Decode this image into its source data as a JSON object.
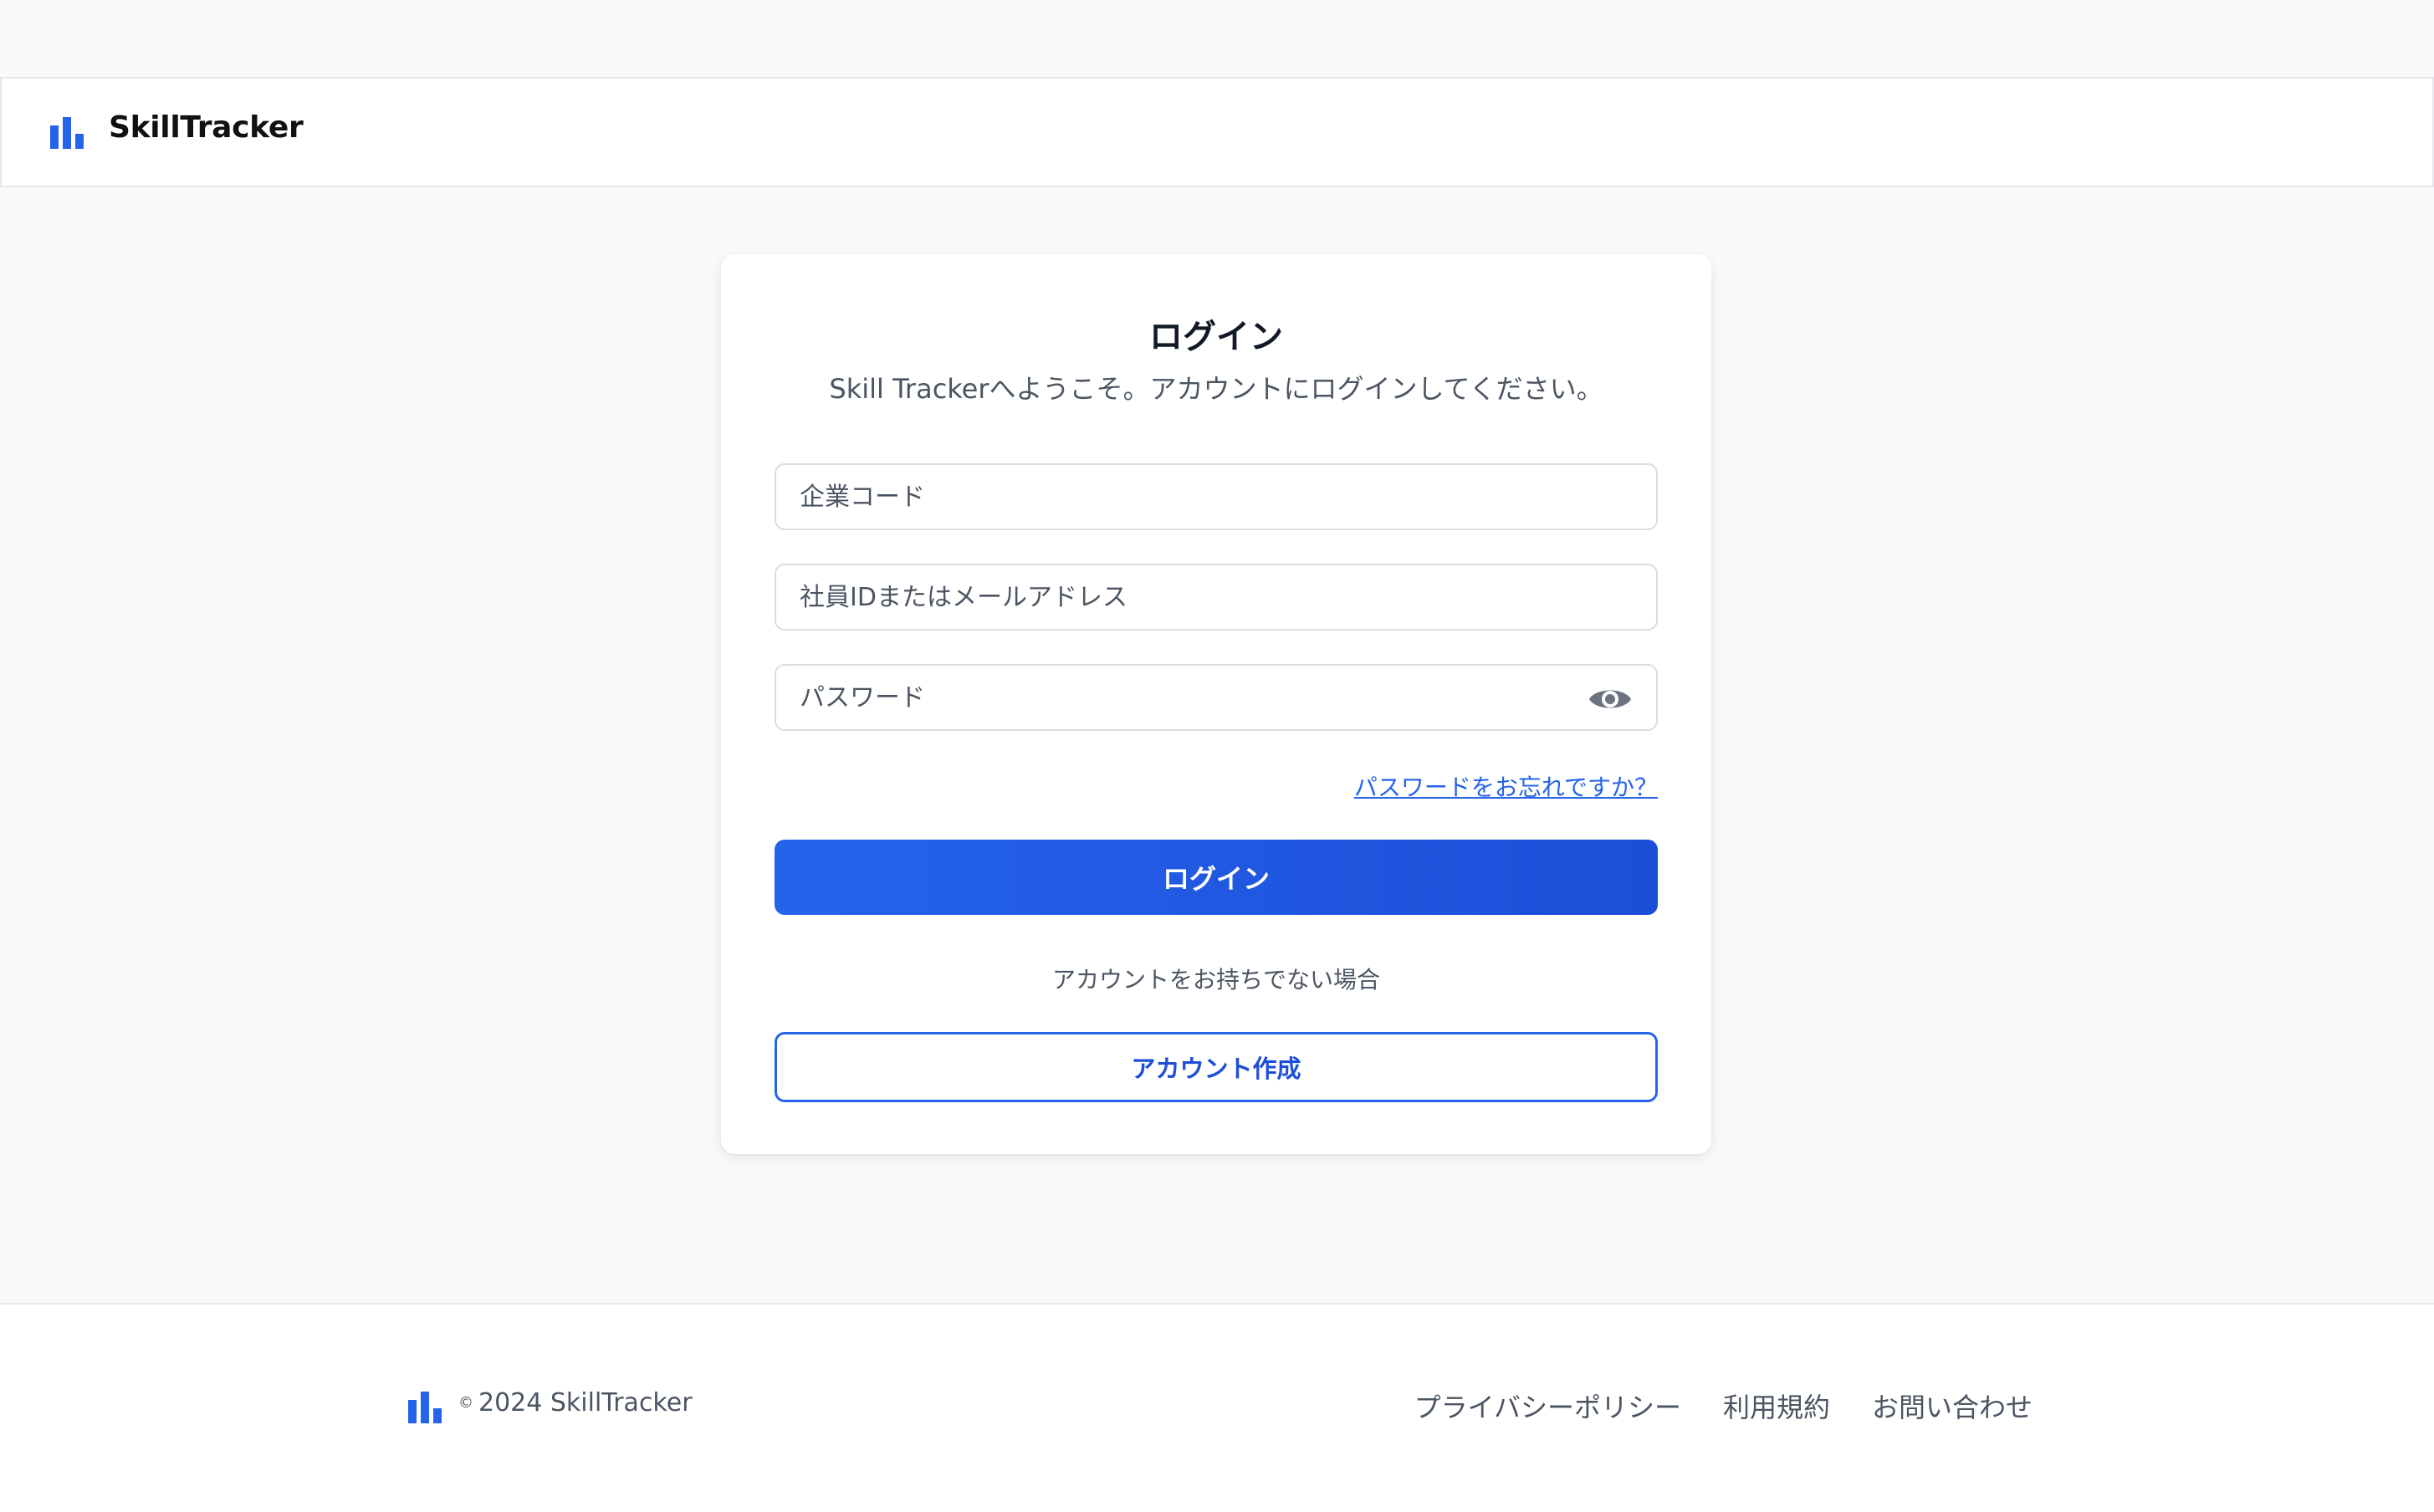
{
  "app": {
    "brand_name": "SkillTracker",
    "brand_icon": "bar-chart-icon",
    "accent_color": "#2563eb"
  },
  "login": {
    "title": "ログイン",
    "subtitle": "Skill Trackerへようこそ。アカウントにログインしてください。",
    "company_code_placeholder": "企業コード",
    "user_id_placeholder": "社員IDまたはメールアドレス",
    "password_placeholder": "パスワード",
    "password_toggle_icon": "eye-icon",
    "forgot_password": "パスワードをお忘れですか？",
    "login_button": "ログイン",
    "no_account_text": "アカウントをお持ちでない場合",
    "create_account_button": "アカウント作成"
  },
  "footer": {
    "copyright_symbol": "©",
    "copyright": "2024 SkillTracker",
    "links": [
      "プライバシーポリシー",
      "利用規約",
      "お問い合わせ"
    ]
  }
}
